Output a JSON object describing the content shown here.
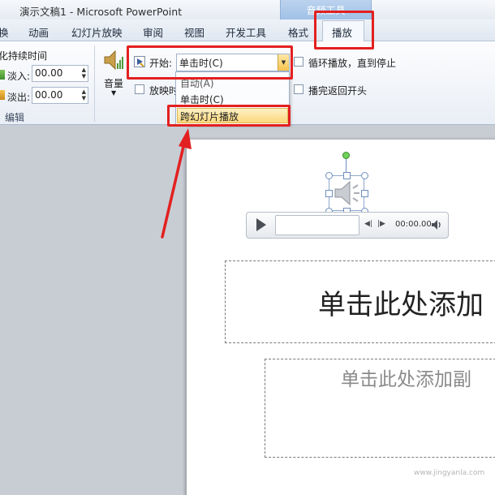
{
  "window": {
    "title": "演示文稿1 - Microsoft PowerPoint",
    "context_group": "音频工具"
  },
  "tabs": [
    {
      "label": "换"
    },
    {
      "label": "动画"
    },
    {
      "label": "幻灯片放映"
    },
    {
      "label": "审阅"
    },
    {
      "label": "视图"
    },
    {
      "label": "开发工具"
    },
    {
      "label": "格式"
    },
    {
      "label": "播放",
      "active": true
    }
  ],
  "ribbon": {
    "fade": {
      "heading": "化持续时间",
      "fade_in_label": "淡入:",
      "fade_in_value": "00.00",
      "fade_out_label": "淡出:",
      "fade_out_value": "00.00",
      "group_label": "编辑"
    },
    "volume_label": "音量",
    "start": {
      "label": "开始:",
      "value": "单击时(C)",
      "options": [
        "自动(A)",
        "单击时(C)",
        "跨幻灯片播放"
      ],
      "highlighted_option": "跨幻灯片播放"
    },
    "hide_during_show_label": "放映时",
    "loop_label": "循环播放，直到停止",
    "rewind_label": "播完返回开头"
  },
  "slide": {
    "title_placeholder": "单击此处添加",
    "subtitle_placeholder": "单击此处添加副"
  },
  "player": {
    "time": "00:00.00"
  },
  "colors": {
    "highlight_red": "#e32020",
    "dropdown_highlight": "#fbd77c"
  },
  "watermark": "www.jingyanla.com"
}
